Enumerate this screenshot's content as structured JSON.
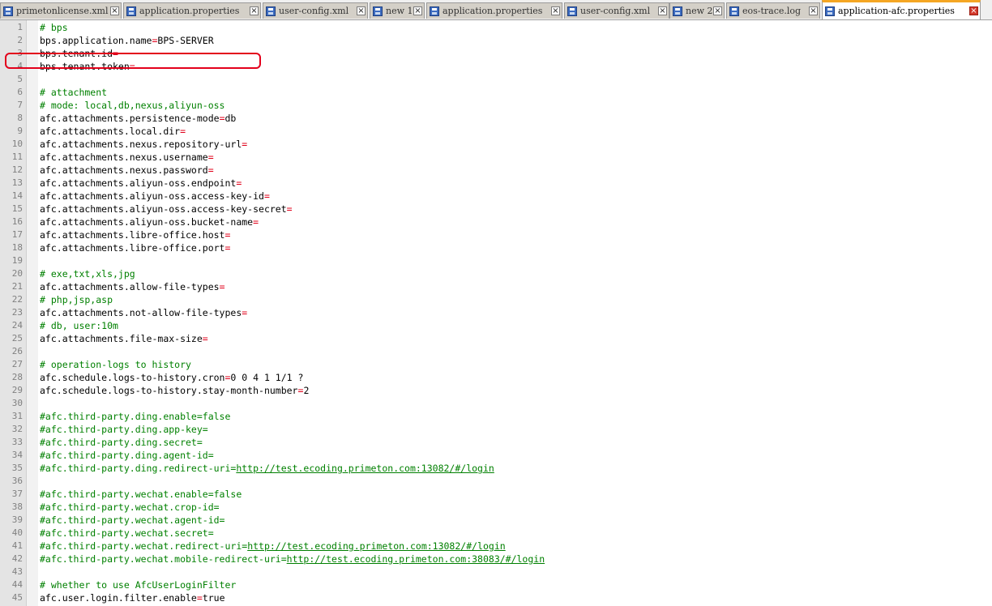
{
  "tabs": [
    {
      "label": "primetonlicense.xml",
      "active": false
    },
    {
      "label": "application.properties",
      "active": false
    },
    {
      "label": "user-config.xml",
      "active": false
    },
    {
      "label": "new 1",
      "active": false
    },
    {
      "label": "application.properties",
      "active": false
    },
    {
      "label": "user-config.xml",
      "active": false
    },
    {
      "label": "new 2",
      "active": false
    },
    {
      "label": "eos-trace.log",
      "active": false
    },
    {
      "label": "application-afc.properties",
      "active": true
    }
  ],
  "lines": [
    {
      "n": "1",
      "comment": "# bps"
    },
    {
      "n": "2",
      "key": "bps.application.name",
      "eq": "=",
      "val": "BPS-SERVER"
    },
    {
      "n": "3",
      "key": "bps.tenant.id",
      "eq": "="
    },
    {
      "n": "4",
      "key": "bps.tenant.token",
      "eq": "="
    },
    {
      "n": "5"
    },
    {
      "n": "6",
      "comment": "# attachment"
    },
    {
      "n": "7",
      "comment": "# mode: local,db,nexus,aliyun-oss"
    },
    {
      "n": "8",
      "key": "afc.attachments.persistence-mode",
      "eq": "=",
      "val": "db"
    },
    {
      "n": "9",
      "key": "afc.attachments.local.dir",
      "eq": "="
    },
    {
      "n": "10",
      "key": "afc.attachments.nexus.repository-url",
      "eq": "="
    },
    {
      "n": "11",
      "key": "afc.attachments.nexus.username",
      "eq": "="
    },
    {
      "n": "12",
      "key": "afc.attachments.nexus.password",
      "eq": "="
    },
    {
      "n": "13",
      "key": "afc.attachments.aliyun-oss.endpoint",
      "eq": "="
    },
    {
      "n": "14",
      "key": "afc.attachments.aliyun-oss.access-key-id",
      "eq": "="
    },
    {
      "n": "15",
      "key": "afc.attachments.aliyun-oss.access-key-secret",
      "eq": "="
    },
    {
      "n": "16",
      "key": "afc.attachments.aliyun-oss.bucket-name",
      "eq": "="
    },
    {
      "n": "17",
      "key": "afc.attachments.libre-office.host",
      "eq": "="
    },
    {
      "n": "18",
      "key": "afc.attachments.libre-office.port",
      "eq": "="
    },
    {
      "n": "19"
    },
    {
      "n": "20",
      "comment": "# exe,txt,xls,jpg"
    },
    {
      "n": "21",
      "key": "afc.attachments.allow-file-types",
      "eq": "="
    },
    {
      "n": "22",
      "comment": "# php,jsp,asp"
    },
    {
      "n": "23",
      "key": "afc.attachments.not-allow-file-types",
      "eq": "="
    },
    {
      "n": "24",
      "comment": "# db, user:10m"
    },
    {
      "n": "25",
      "key": "afc.attachments.file-max-size",
      "eq": "="
    },
    {
      "n": "26"
    },
    {
      "n": "27",
      "comment": "# operation-logs to history"
    },
    {
      "n": "28",
      "key": "afc.schedule.logs-to-history.cron",
      "eq": "=",
      "val": "0 0 4 1 1/1 ?"
    },
    {
      "n": "29",
      "key": "afc.schedule.logs-to-history.stay-month-number",
      "eq": "=",
      "val": "2"
    },
    {
      "n": "30"
    },
    {
      "n": "31",
      "comment": "#afc.third-party.ding.enable=false"
    },
    {
      "n": "32",
      "comment": "#afc.third-party.ding.app-key="
    },
    {
      "n": "33",
      "comment": "#afc.third-party.ding.secret="
    },
    {
      "n": "34",
      "comment": "#afc.third-party.ding.agent-id="
    },
    {
      "n": "35",
      "comment": "#afc.third-party.ding.redirect-uri=",
      "url": "http://test.ecoding.primeton.com:13082/#/login"
    },
    {
      "n": "36"
    },
    {
      "n": "37",
      "comment": "#afc.third-party.wechat.enable=false"
    },
    {
      "n": "38",
      "comment": "#afc.third-party.wechat.crop-id="
    },
    {
      "n": "39",
      "comment": "#afc.third-party.wechat.agent-id="
    },
    {
      "n": "40",
      "comment": "#afc.third-party.wechat.secret="
    },
    {
      "n": "41",
      "comment": "#afc.third-party.wechat.redirect-uri=",
      "url": "http://test.ecoding.primeton.com:13082/#/login"
    },
    {
      "n": "42",
      "comment": "#afc.third-party.wechat.mobile-redirect-uri=",
      "url": "http://test.ecoding.primeton.com:38083/#/login"
    },
    {
      "n": "43"
    },
    {
      "n": "44",
      "comment": "# whether to use AfcUserLoginFilter"
    },
    {
      "n": "45",
      "key": "afc.user.login.filter.enable",
      "eq": "=",
      "val": "true"
    }
  ],
  "icons": {
    "tab_file": "save-icon",
    "tab_close": "close-icon"
  },
  "colors": {
    "comment": "#008000",
    "equals": "#e0001a",
    "highlight": "#e3001b",
    "active_tab_accent": "#f5a623"
  }
}
